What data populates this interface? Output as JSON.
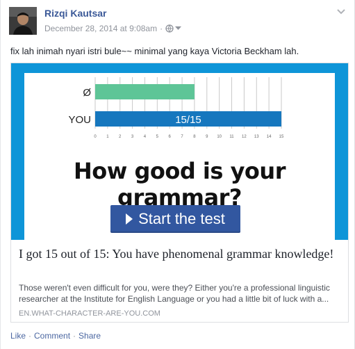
{
  "post": {
    "author": "Rizqi Kautsar",
    "date": "December 28, 2014 at 9:08am",
    "meta_separator": "·",
    "privacy_icon": "globe-icon",
    "menu_icon": "chevron-down-icon",
    "status_text": "fix lah inimah nyari istri bule~~ minimal yang kaya Victoria Beckham lah."
  },
  "link_preview": {
    "image": {
      "headline": "How good is your grammar?",
      "button_label": "Start the test",
      "button_color": "#3257a0",
      "frame_color": "#0e95d8"
    },
    "title": "I got 15 out of 15: You have phenomenal grammar knowledge!",
    "description": "Those weren't even difficult for you, were they? Either you're a professional linguistic researcher at the Institute for English Language or you had a little bit of luck with a...",
    "domain": "EN.WHAT-CHARACTER-ARE-YOU.COM"
  },
  "actions": {
    "like": "Like",
    "comment": "Comment",
    "share": "Share",
    "separator": "·"
  },
  "chart_data": {
    "type": "bar",
    "orientation": "horizontal",
    "categories": [
      "Ø",
      "YOU"
    ],
    "values": [
      8,
      15
    ],
    "colors": [
      "#5ec597",
      "#1677be"
    ],
    "bar_labels": [
      "",
      "15/15"
    ],
    "xlim": [
      0,
      15
    ],
    "xticks": [
      "0",
      "1",
      "2",
      "3",
      "4",
      "5",
      "6",
      "7",
      "8",
      "9",
      "10",
      "11",
      "12",
      "13",
      "14",
      "15"
    ],
    "grid": true
  }
}
